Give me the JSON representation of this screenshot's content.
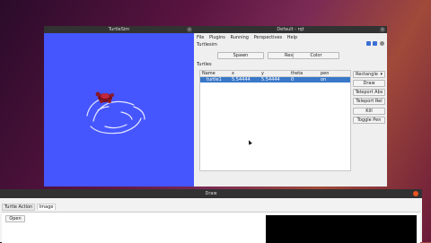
{
  "turtlesim": {
    "title": "TurtleSim"
  },
  "rqt": {
    "title": "Default - rqt",
    "menu": [
      "File",
      "Plugins",
      "Running",
      "Perspectives",
      "Help"
    ],
    "plugin_title": "Turtlesim",
    "toolbar_icons": [
      "help-icon",
      "reload-icon",
      "close-icon"
    ],
    "buttons": {
      "spawn": "Spawn",
      "reset": "Reset",
      "color": "Color"
    },
    "turtles_label": "Turtles",
    "table": {
      "headers": [
        "Name",
        "x",
        "y",
        "theta",
        "pen"
      ],
      "rows": [
        {
          "name": "turtle1",
          "x": "5.54444",
          "y": "5.54444",
          "theta": "0",
          "pen": "on"
        }
      ]
    },
    "shape_select": "Rectangle",
    "side_buttons": [
      "Draw",
      "Teleport Abs",
      "Teleport Rel",
      "Kill",
      "Toggle Pen"
    ]
  },
  "draw": {
    "title": "Draw",
    "tabs": [
      "Turtle Action",
      "Image"
    ],
    "open_label": "Open"
  }
}
